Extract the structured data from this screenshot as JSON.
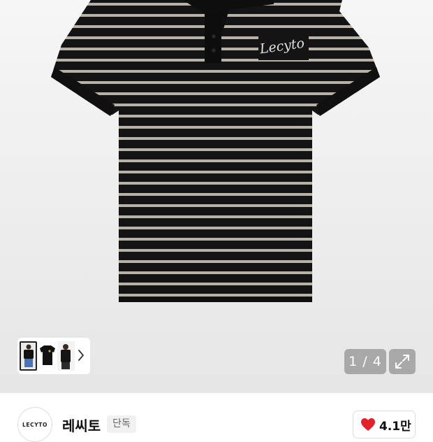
{
  "gallery": {
    "product_image": {
      "subject": "black polo shirt with beige horizontal stripes",
      "embroidered_text": "Lecyto",
      "colors": {
        "shirt": "#141414",
        "stripe": "#b9b1a6",
        "embroidery": "#e2e2e2"
      }
    },
    "thumbnails": {
      "items": [
        {
          "icon": "model-front-thumbnail"
        },
        {
          "icon": "shirt-flat-thumbnail"
        },
        {
          "icon": "model-back-thumbnail"
        }
      ],
      "more_icon": "chevron-right-icon"
    },
    "pager": "1 / 4",
    "expand_icon": "expand-icon"
  },
  "brand": {
    "logo_text": "LECYTO",
    "name": "레씨토",
    "badge": "단독",
    "like": {
      "icon": "heart-icon",
      "count": "4.1만",
      "color": "#e4212b"
    }
  }
}
